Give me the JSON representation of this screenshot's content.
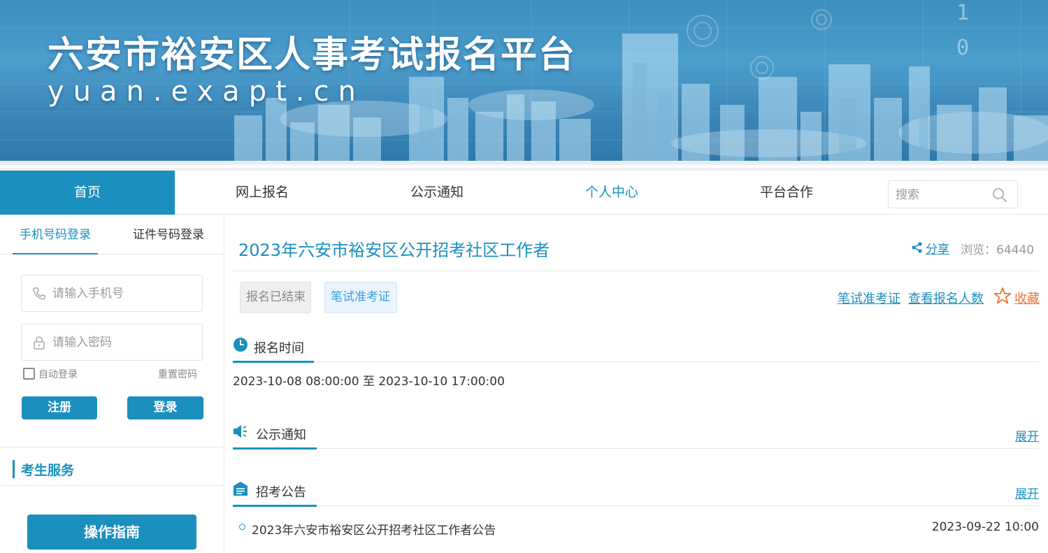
{
  "banner": {
    "title": "六安市裕安区人事考试报名平台",
    "subtitle": "yuan.exapt.cn"
  },
  "nav": {
    "items": [
      {
        "label": "首页",
        "state": "active"
      },
      {
        "label": "网上报名",
        "state": "normal"
      },
      {
        "label": "公示通知",
        "state": "normal"
      },
      {
        "label": "个人中心",
        "state": "highlight"
      },
      {
        "label": "平台合作",
        "state": "normal"
      }
    ],
    "search_placeholder": "搜索"
  },
  "login": {
    "tabs": [
      "手机号码登录",
      "证件号码登录"
    ],
    "phone_placeholder": "请输入手机号",
    "password_placeholder": "请输入密码",
    "remember_label": "自动登录",
    "reset_label": "重置密码",
    "register_label": "注册",
    "login_label": "登录"
  },
  "services": {
    "title": "考生服务",
    "guide_label": "操作指南"
  },
  "exam": {
    "title": "2023年六安市裕安区公开招考社区工作者",
    "share_label": "分享",
    "views_label": "浏览：",
    "views_count": "64440",
    "status_tag": "报名已结束",
    "ticket_tag": "笔试准考证",
    "links": {
      "ticket": "笔试准考证",
      "applicants": "查看报名人数",
      "favorite": "收藏"
    }
  },
  "sections": {
    "registration_time": {
      "title": "报名时间",
      "period": "2023-10-08 08:00:00 至 2023-10-10 17:00:00"
    },
    "notice": {
      "title": "公示通知",
      "expand": "展开"
    },
    "announcement": {
      "title": "招考公告",
      "expand": "展开",
      "items": [
        {
          "title": "2023年六安市裕安区公开招考社区工作者公告",
          "date": "2023-09-22 10:00"
        }
      ]
    }
  },
  "colors": {
    "accent": "#1b8fbe",
    "favorite": "#e8753a",
    "muted": "#999999"
  }
}
